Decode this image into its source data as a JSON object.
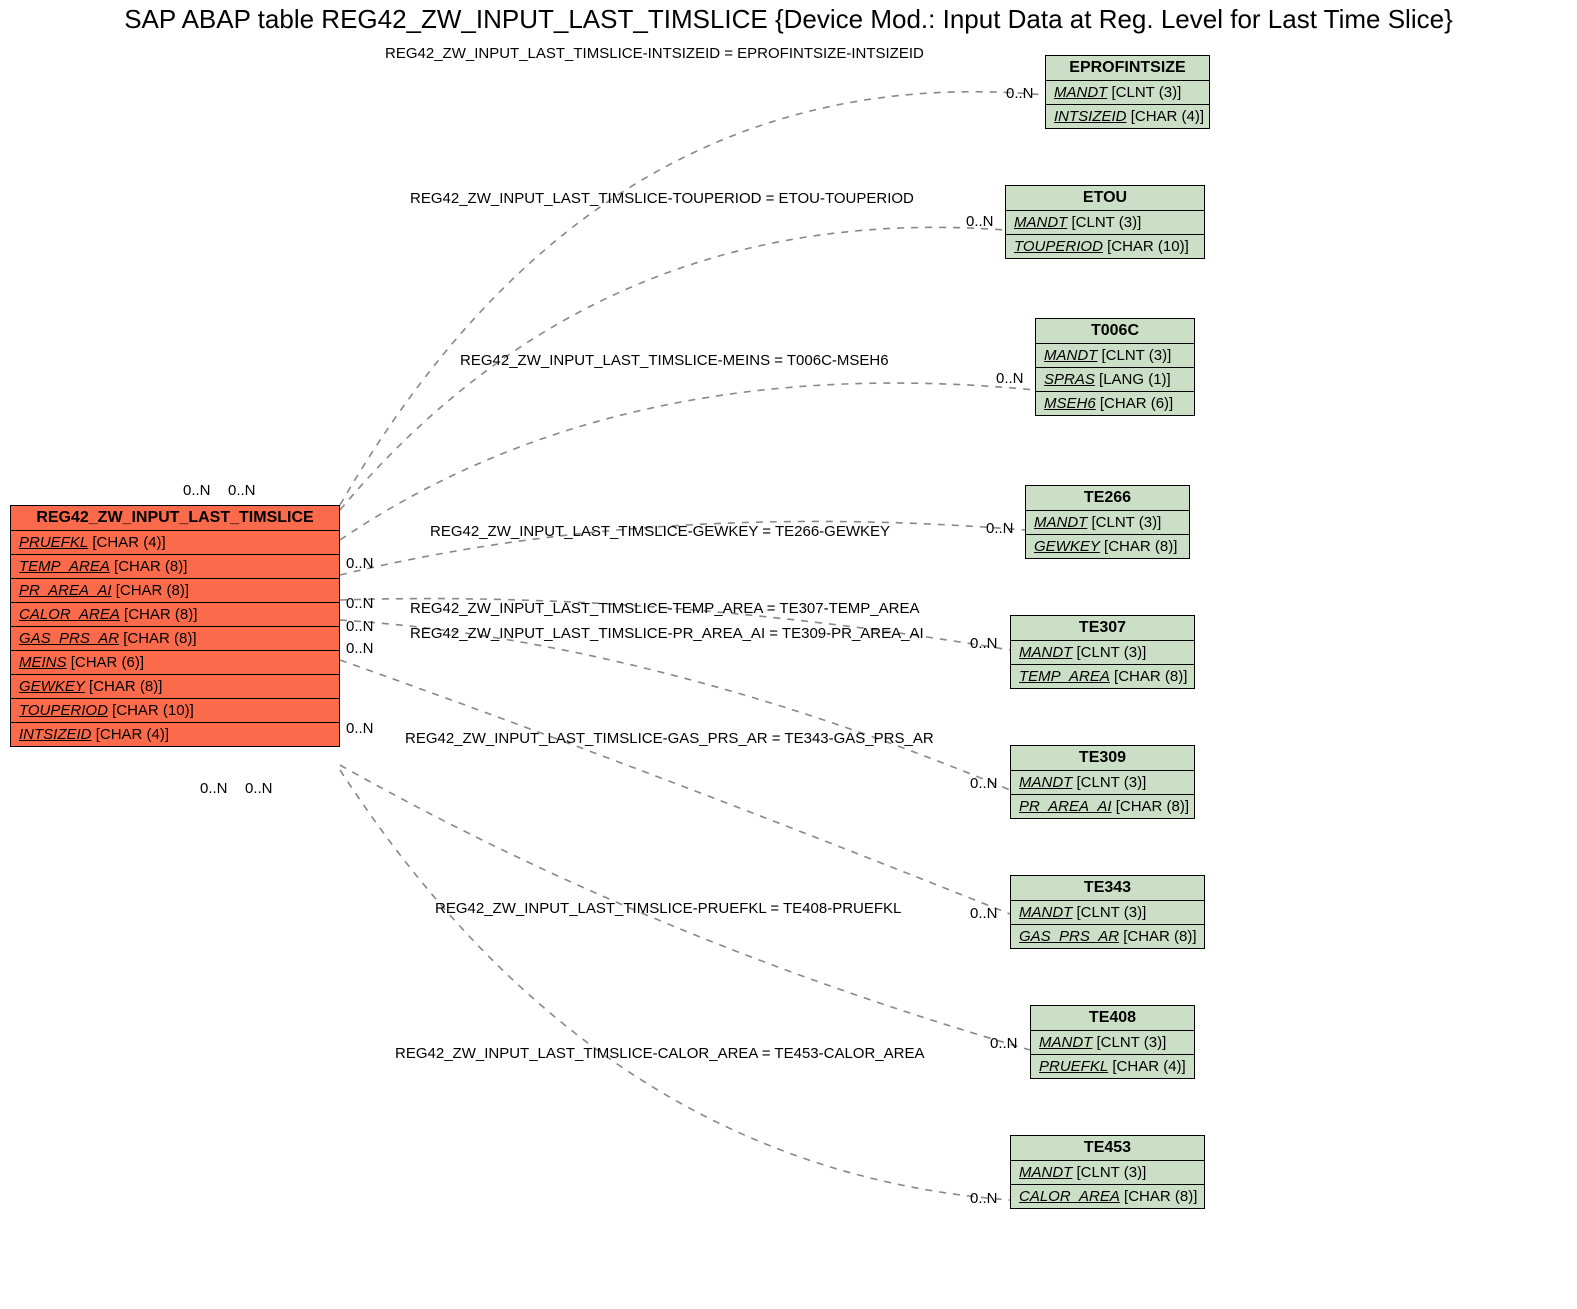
{
  "title": "SAP ABAP table REG42_ZW_INPUT_LAST_TIMSLICE {Device Mod.: Input Data at Reg. Level for Last Time Slice}",
  "mainEntity": {
    "name": "REG42_ZW_INPUT_LAST_TIMSLICE",
    "fields": [
      {
        "name": "PRUEFKL",
        "type": "[CHAR (4)]"
      },
      {
        "name": "TEMP_AREA",
        "type": "[CHAR (8)]"
      },
      {
        "name": "PR_AREA_AI",
        "type": "[CHAR (8)]"
      },
      {
        "name": "CALOR_AREA",
        "type": "[CHAR (8)]"
      },
      {
        "name": "GAS_PRS_AR",
        "type": "[CHAR (8)]"
      },
      {
        "name": "MEINS",
        "type": "[CHAR (6)]"
      },
      {
        "name": "GEWKEY",
        "type": "[CHAR (8)]"
      },
      {
        "name": "TOUPERIOD",
        "type": "[CHAR (10)]"
      },
      {
        "name": "INTSIZEID",
        "type": "[CHAR (4)]"
      }
    ]
  },
  "refEntities": [
    {
      "name": "EPROFINTSIZE",
      "fields": [
        {
          "name": "MANDT",
          "type": "[CLNT (3)]"
        },
        {
          "name": "INTSIZEID",
          "type": "[CHAR (4)]"
        }
      ]
    },
    {
      "name": "ETOU",
      "fields": [
        {
          "name": "MANDT",
          "type": "[CLNT (3)]"
        },
        {
          "name": "TOUPERIOD",
          "type": "[CHAR (10)]"
        }
      ]
    },
    {
      "name": "T006C",
      "fields": [
        {
          "name": "MANDT",
          "type": "[CLNT (3)]"
        },
        {
          "name": "SPRAS",
          "type": "[LANG (1)]"
        },
        {
          "name": "MSEH6",
          "type": "[CHAR (6)]"
        }
      ]
    },
    {
      "name": "TE266",
      "fields": [
        {
          "name": "MANDT",
          "type": "[CLNT (3)]"
        },
        {
          "name": "GEWKEY",
          "type": "[CHAR (8)]"
        }
      ]
    },
    {
      "name": "TE307",
      "fields": [
        {
          "name": "MANDT",
          "type": "[CLNT (3)]"
        },
        {
          "name": "TEMP_AREA",
          "type": "[CHAR (8)]"
        }
      ]
    },
    {
      "name": "TE309",
      "fields": [
        {
          "name": "MANDT",
          "type": "[CLNT (3)]"
        },
        {
          "name": "PR_AREA_AI",
          "type": "[CHAR (8)]"
        }
      ]
    },
    {
      "name": "TE343",
      "fields": [
        {
          "name": "MANDT",
          "type": "[CLNT (3)]"
        },
        {
          "name": "GAS_PRS_AR",
          "type": "[CHAR (8)]"
        }
      ]
    },
    {
      "name": "TE408",
      "fields": [
        {
          "name": "MANDT",
          "type": "[CLNT (3)]"
        },
        {
          "name": "PRUEFKL",
          "type": "[CHAR (4)]"
        }
      ]
    },
    {
      "name": "TE453",
      "fields": [
        {
          "name": "MANDT",
          "type": "[CLNT (3)]"
        },
        {
          "name": "CALOR_AREA",
          "type": "[CHAR (8)]"
        }
      ]
    }
  ],
  "relLabels": [
    {
      "text": "REG42_ZW_INPUT_LAST_TIMSLICE-INTSIZEID = EPROFINTSIZE-INTSIZEID"
    },
    {
      "text": "REG42_ZW_INPUT_LAST_TIMSLICE-TOUPERIOD = ETOU-TOUPERIOD"
    },
    {
      "text": "REG42_ZW_INPUT_LAST_TIMSLICE-MEINS = T006C-MSEH6"
    },
    {
      "text": "REG42_ZW_INPUT_LAST_TIMSLICE-GEWKEY = TE266-GEWKEY"
    },
    {
      "text": "REG42_ZW_INPUT_LAST_TIMSLICE-TEMP_AREA = TE307-TEMP_AREA"
    },
    {
      "text": "REG42_ZW_INPUT_LAST_TIMSLICE-PR_AREA_AI = TE309-PR_AREA_AI"
    },
    {
      "text": "REG42_ZW_INPUT_LAST_TIMSLICE-GAS_PRS_AR = TE343-GAS_PRS_AR"
    },
    {
      "text": "REG42_ZW_INPUT_LAST_TIMSLICE-PRUEFKL = TE408-PRUEFKL"
    },
    {
      "text": "REG42_ZW_INPUT_LAST_TIMSLICE-CALOR_AREA = TE453-CALOR_AREA"
    }
  ],
  "cardinality": "0..N"
}
